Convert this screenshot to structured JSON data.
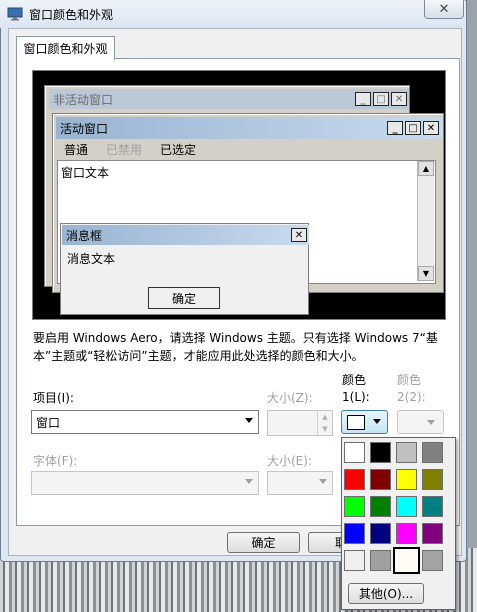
{
  "window": {
    "title": "窗口颜色和外观",
    "close_glyph": "✕"
  },
  "tab": {
    "label": "窗口颜色和外观"
  },
  "preview": {
    "inactive_title": "非活动窗口",
    "active_title": "活动窗口",
    "menu_items": [
      "普通",
      "已禁用",
      "已选定"
    ],
    "window_text": "窗口文本",
    "message_box_title": "消息框",
    "message_text": "消息文本",
    "ok_label": "确定",
    "caption_buttons": [
      "_",
      "□",
      "✕"
    ]
  },
  "info_text": "要启用 Windows Aero，请选择 Windows 主题。只有选择 Windows 7“基本”主题或“轻松访问”主题，才能应用此处选择的颜色和大小。",
  "form": {
    "item_label": "项目(I):",
    "item_value": "窗口",
    "size_label": "大小(Z):",
    "color1_label_line1": "颜色",
    "color1_label_line2": "1(L):",
    "color2_label_line1": "颜色",
    "color2_label_line2": "2(2):",
    "font_label": "字体(F):",
    "font_size_label": "大小(E):"
  },
  "palette": {
    "colors": [
      "#ffffff",
      "#000000",
      "#c0c0c0",
      "#808080",
      "#ff0000",
      "#800000",
      "#ffff00",
      "#808000",
      "#00ff00",
      "#008000",
      "#00ffff",
      "#008080",
      "#0000ff",
      "#000080",
      "#ff00ff",
      "#800080",
      "#f0f0f0",
      "#a0a0a0",
      "#fffbf0",
      "#a4a4a4"
    ],
    "selected_index": 18,
    "other_label": "其他(O)..."
  },
  "buttons": {
    "ok": "确定",
    "cancel_partial": "取"
  }
}
